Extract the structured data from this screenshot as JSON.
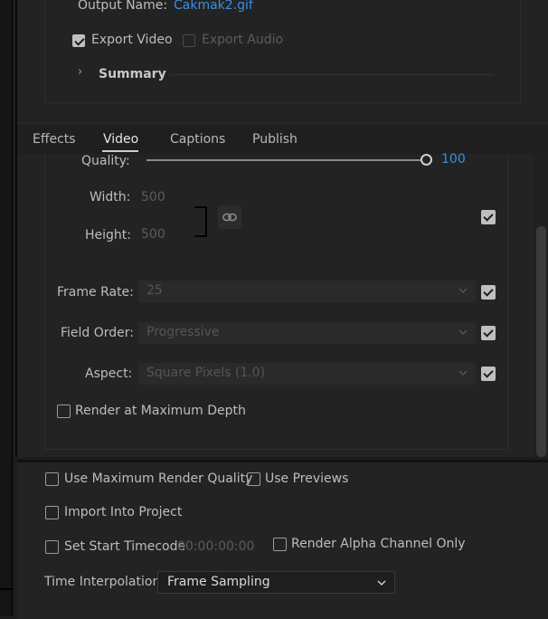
{
  "output": {
    "name_label": "Output Name:",
    "name_value": "Cakmak2.gif",
    "export_video_label": "Export Video",
    "export_video_checked": true,
    "export_audio_label": "Export Audio",
    "export_audio_checked": false,
    "summary_label": "Summary"
  },
  "tabs": [
    {
      "label": "Effects"
    },
    {
      "label": "Video",
      "active": true
    },
    {
      "label": "Captions"
    },
    {
      "label": "Publish"
    }
  ],
  "video": {
    "quality_label": "Quality:",
    "quality_value": "100",
    "width_label": "Width:",
    "width_value": "500",
    "height_label": "Height:",
    "height_value": "500",
    "frame_rate_label": "Frame Rate:",
    "frame_rate_value": "25",
    "field_order_label": "Field Order:",
    "field_order_value": "Progressive",
    "aspect_label": "Aspect:",
    "aspect_value": "Square Pixels (1.0)",
    "render_max_depth_label": "Render at Maximum Depth"
  },
  "bottom": {
    "use_max_render_quality_label": "Use Maximum Render Quality",
    "use_previews_label": "Use Previews",
    "import_into_project_label": "Import Into Project",
    "set_start_timecode_label": "Set Start Timecode",
    "start_timecode_value": "00:00:00:00",
    "render_alpha_label": "Render Alpha Channel Only",
    "time_interpolation_label": "Time Interpolation:",
    "time_interpolation_value": "Frame Sampling"
  },
  "colors": {
    "accent": "#3a8fe3",
    "background": "#232323"
  }
}
